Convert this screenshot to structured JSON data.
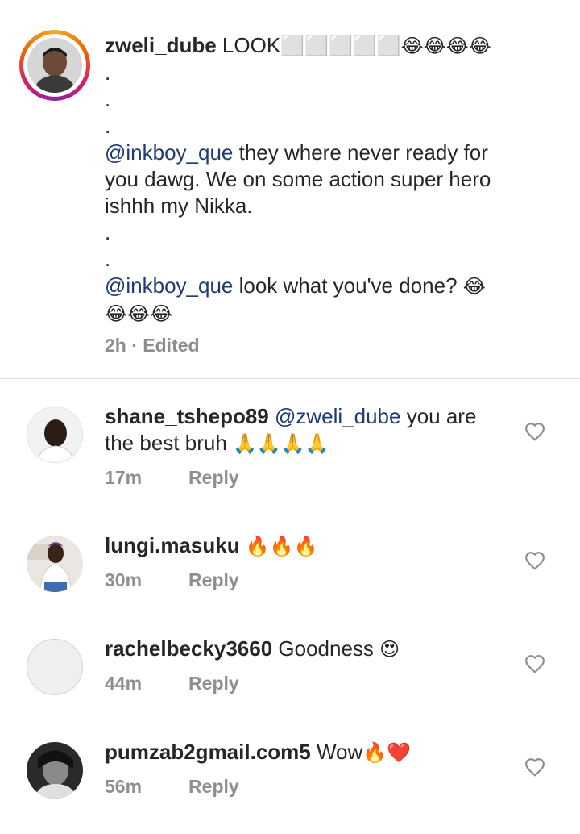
{
  "caption": {
    "username": "zweli_dube",
    "lines": [
      {
        "text": " LOOK",
        "emoji": "⬜⬜⬜⬜⬜😂😂😂😂"
      },
      {
        "text": "."
      },
      {
        "text": "."
      },
      {
        "text": "."
      },
      {
        "mention": "@inkboy_que",
        "text": " they where never ready for"
      },
      {
        "text": "you dawg. We on some action super hero"
      },
      {
        "text": "ishhh my Nikka."
      },
      {
        "text": "."
      },
      {
        "text": "."
      },
      {
        "mention": "@inkboy_que",
        "text": " look what you've done? ",
        "emoji": "😂"
      },
      {
        "emoji": "😂😂😂"
      }
    ],
    "time": "2h",
    "edited": "· Edited"
  },
  "comments": [
    {
      "username": "shane_tshepo89",
      "mention": "@zweli_dube",
      "text1": " you are",
      "text2": "the best bruh ",
      "emoji": "🙏🙏🙏🙏",
      "time": "17m",
      "reply": "Reply"
    },
    {
      "username": "lungi.masuku",
      "text1": " ",
      "emoji": "🔥🔥🔥",
      "time": "30m",
      "reply": "Reply"
    },
    {
      "username": "rachelbecky3660",
      "text1": " Goodness ",
      "emoji": "😍",
      "time": "44m",
      "reply": "Reply"
    },
    {
      "username": "pumzab2gmail.com5",
      "text1": " Wow",
      "emoji": "🔥❤️",
      "time": "56m",
      "reply": "Reply"
    }
  ],
  "icons": {
    "heart": "heart-outline-icon"
  },
  "colors": {
    "mention": "#1f3b6f",
    "meta": "#8e8e8e",
    "text": "#262626",
    "divider": "#dbdbdb"
  }
}
